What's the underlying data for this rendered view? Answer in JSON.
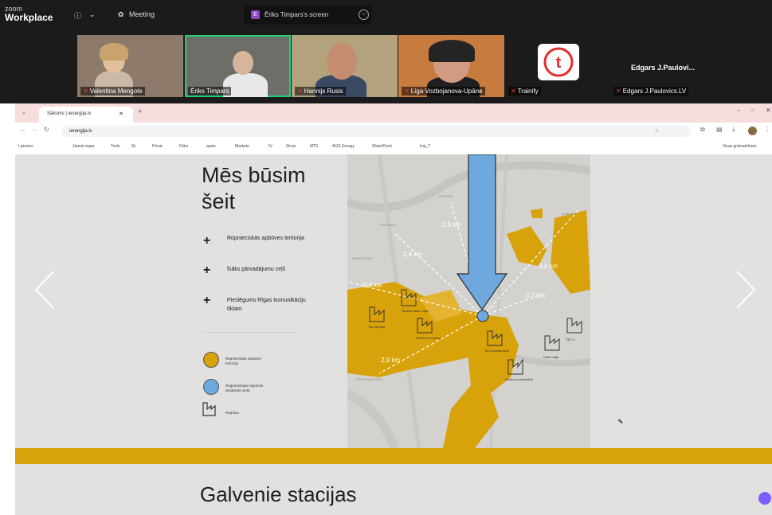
{
  "zoom": {
    "logo_line1": "zoom",
    "logo_line2": "Workplace",
    "info_icon": "info-icon",
    "meeting_label": "Meeting",
    "share_badge": "E",
    "share_label": "Ēriks Timpars's screen"
  },
  "participants": [
    {
      "name": "Valentina Mengote",
      "muted": true
    },
    {
      "name": "Ēriks Timpars",
      "muted": false,
      "active_speaker": true
    },
    {
      "name": "Hannijs Rusis",
      "muted": true
    },
    {
      "name": "Līga Vozbojanova-Upāne",
      "muted": true
    },
    {
      "name": "Trainify",
      "muted": true
    }
  ],
  "edgars": {
    "display_name": "Edgars J.Paulovi...",
    "tag": "Edgars J.Paulovics.LV"
  },
  "browser": {
    "tab_title": "Sākums | ienergija.lv",
    "url": "ienergija.lv",
    "bookmarks": [
      "Latvines",
      "Jaunā mape",
      "Tools",
      "SL",
      "Privat",
      "Fitter",
      "apsis",
      "Markets",
      "IV",
      "Zinas",
      "MTE",
      "AGS Energy",
      "SharePoint",
      "Izsj_T"
    ],
    "bookmarks_right": "Visas grāmatzīmes"
  },
  "page": {
    "title_line1": "Mēs būsim",
    "title_line2": "šeit",
    "bullets": [
      "Rūpnieciskās apbūves teritorija",
      "Īsāks pārvadājumu ceļš",
      "Pieslēgums Rīgas komunikāciju tīklam"
    ],
    "legend": [
      {
        "label": "Rūpnieciskās apbūves teritorija",
        "color": "#d8a20a"
      },
      {
        "label": "Reģenerācijas rūpnīcas atrašanās vieta",
        "color": "#6fa8dc"
      },
      {
        "label": "Rūpnīca",
        "color": ""
      }
    ],
    "heading2": "Galvenie stacijas"
  },
  "map": {
    "distances": [
      "2,5 km",
      "2,4 km",
      "3,2 km",
      "3,8 km",
      "0,7 km",
      "2,9 km"
    ],
    "place_labels": [
      "DREILIŅI",
      "PLAVNIEKI",
      "ULBROKA",
      "BĀRZU APLIS",
      "STROGANOVSKA"
    ],
    "factories": [
      "Skrotes katlu māja",
      "Tilu rūpnīca",
      "Ražotnes rūpnīca",
      "Tilu biomasa lielā",
      "Katlu māja",
      "TEC-2",
      "Atkritumu pārstrāde"
    ]
  },
  "colors": {
    "accent": "#d8a20a",
    "blue": "#6fa8dc"
  }
}
